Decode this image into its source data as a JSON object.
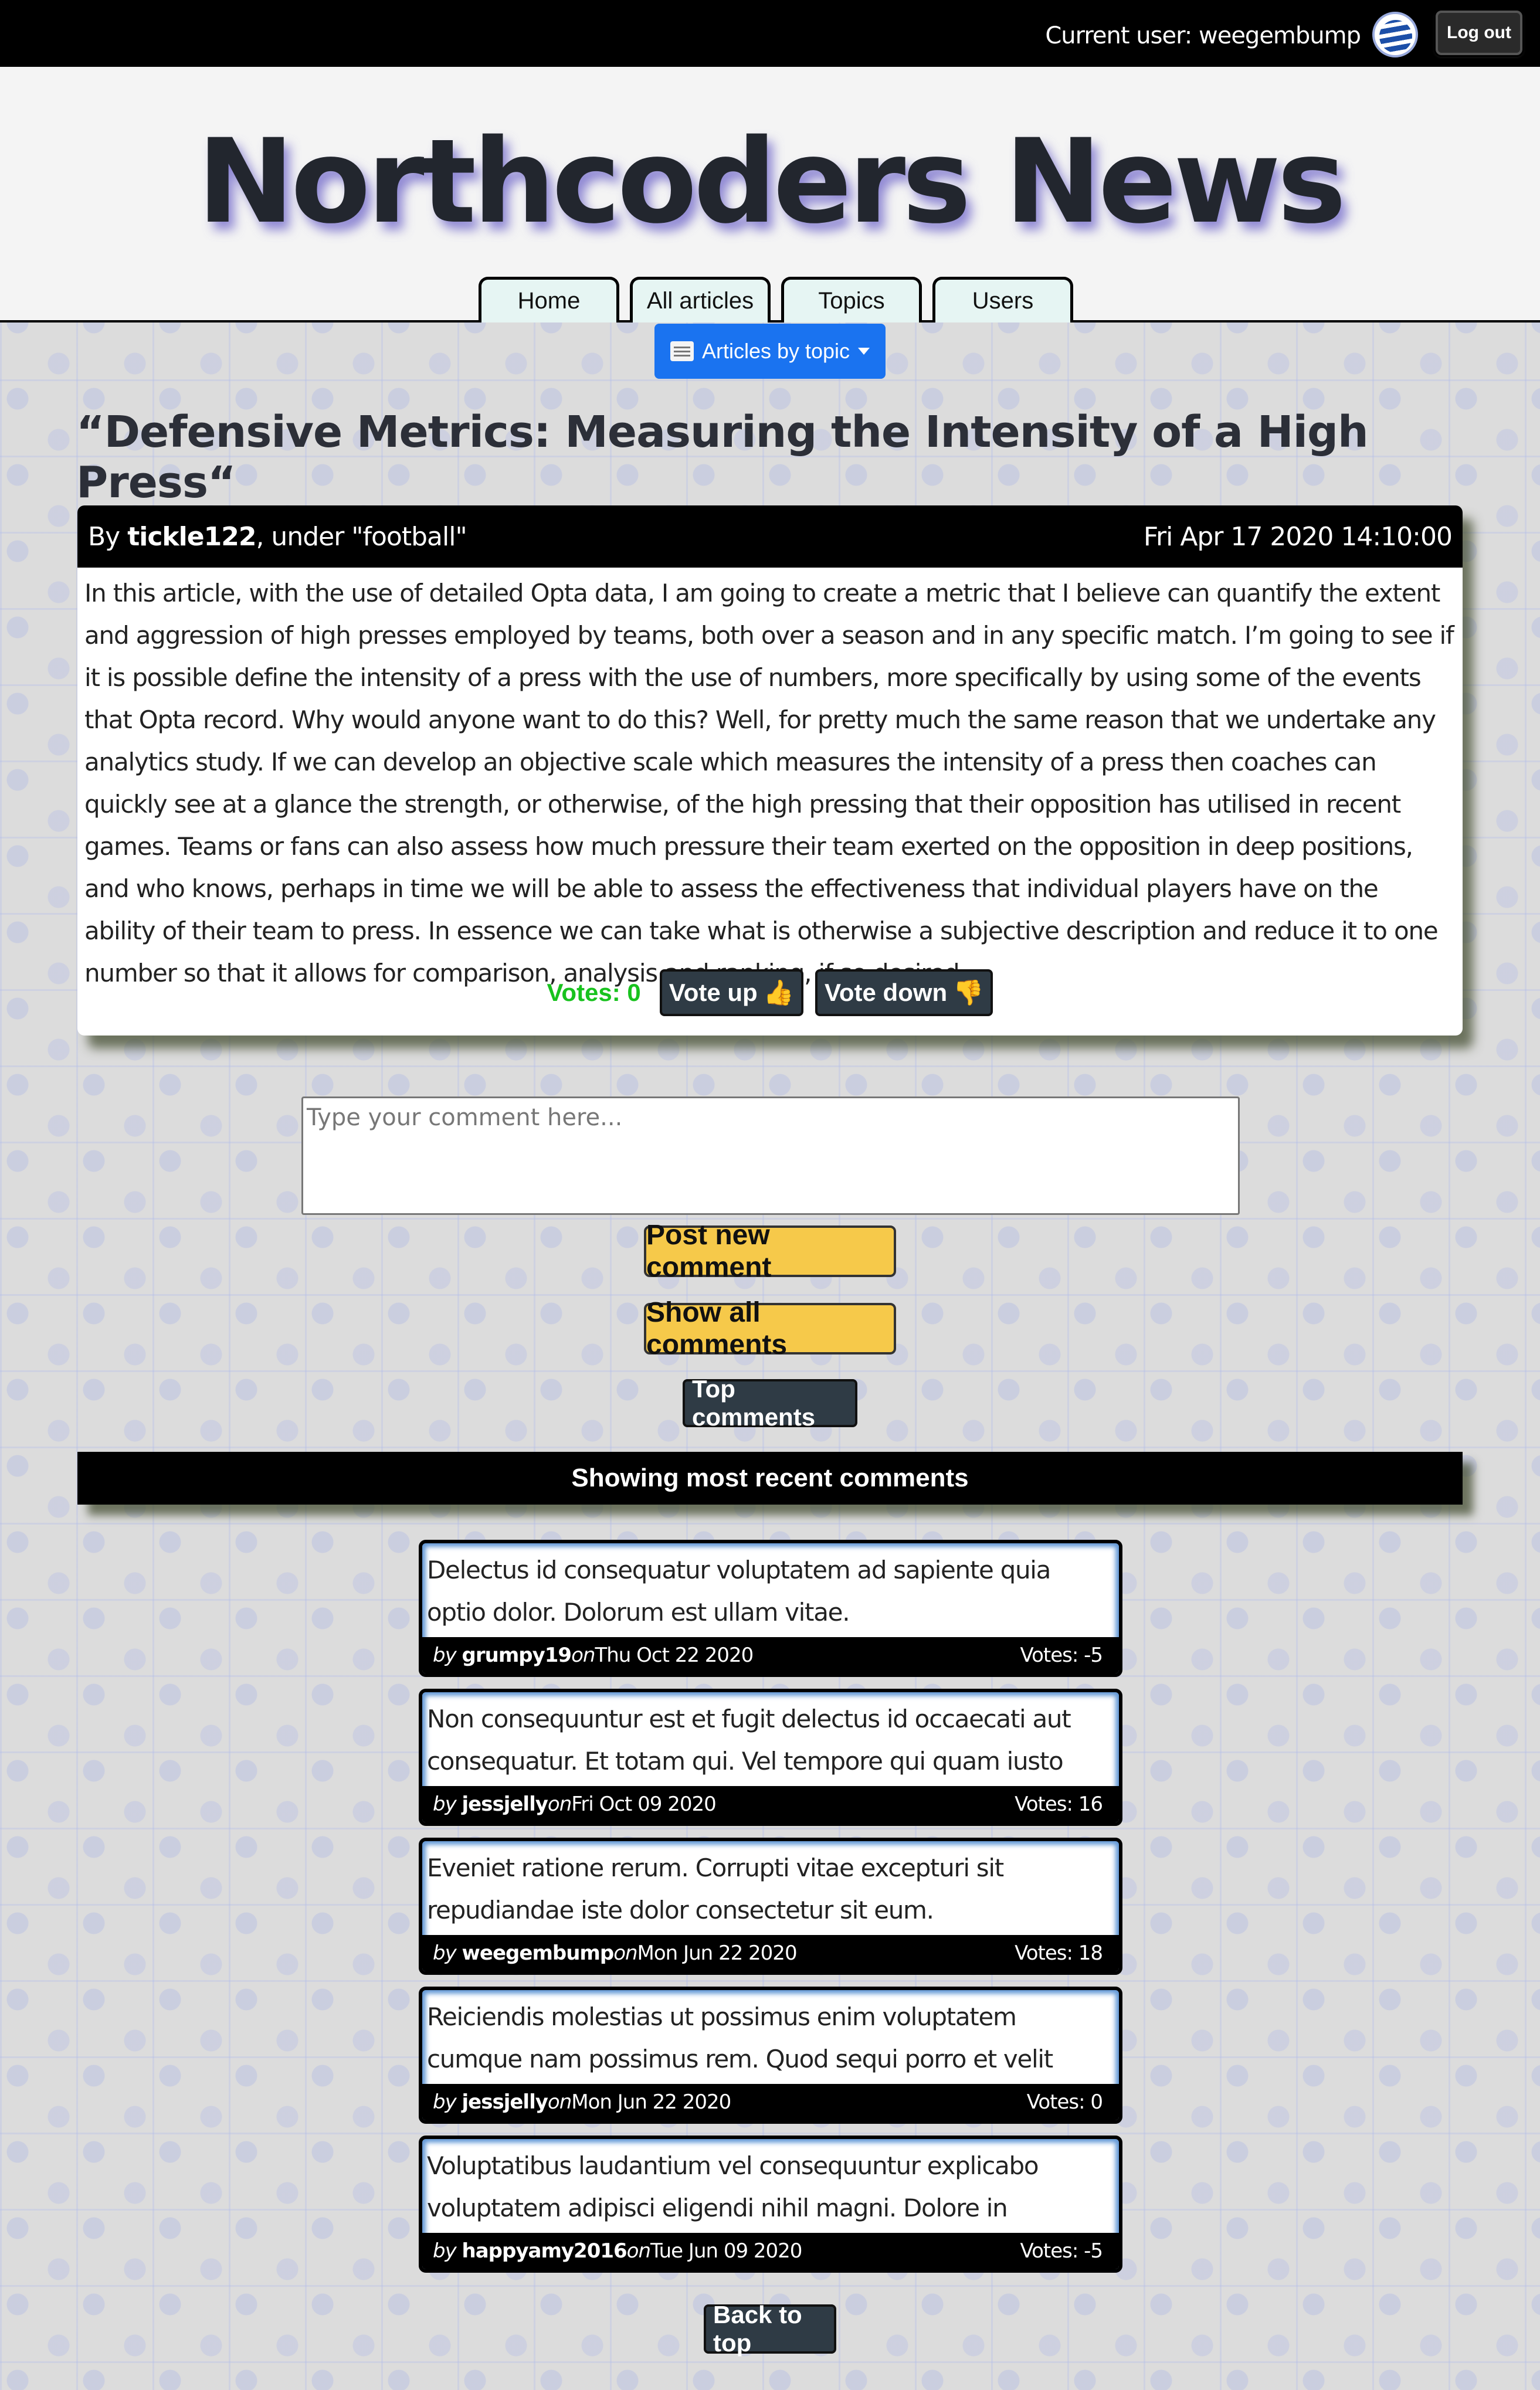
{
  "topbar": {
    "current_user": "Current user: weegembump",
    "logout_label": "Log out"
  },
  "header": {
    "title": "Northcoders News",
    "nav": [
      "Home",
      "All articles",
      "Topics",
      "Users"
    ]
  },
  "topic_dropdown": {
    "label": "Articles by topic",
    "icon": "newspaper-icon"
  },
  "article": {
    "title": "“Defensive Metrics: Measuring the Intensity of a High Press“",
    "by_prefix": "By ",
    "author": "tickle122",
    "topic_text": ", under \"football\"",
    "date": "Fri Apr 17 2020 14:10:00",
    "body": "In this article, with the use of detailed Opta data, I am going to create a metric that I believe can quantify the extent and aggression of high presses employed by teams, both over a season and in any specific match. I’m going to see if it is possible define the intensity of a press with the use of numbers, more specifically by using some of the events that Opta record. Why would anyone want to do this? Well, for pretty much the same reason that we undertake any analytics study. If we can develop an objective scale which measures the intensity of a press then coaches can quickly see at a glance the strength, or otherwise, of the high pressing that their opposition has utilised in recent games. Teams or fans can also assess how much pressure their team exerted on the opposition in deep positions, and who knows, perhaps in time we will be able to assess the effectiveness that individual players have on the ability of their team to press. In essence we can take what is otherwise a subjective description and reduce it to one number so that it allows for comparison, analysis and ranking, if so desired.",
    "votes": "Votes: 0",
    "vote_up": "Vote up",
    "vote_down": "Vote down"
  },
  "comment_form": {
    "placeholder": "Type your comment here...",
    "post_label": "Post new comment",
    "show_all_label": "Show all comments",
    "top_comments_label": "Top comments"
  },
  "comments_banner": "Showing most recent comments",
  "comments": [
    {
      "text": "Delectus id consequatur voluptatem ad sapiente quia optio dolor. Dolorum est ullam vitae.",
      "by": "by ",
      "author": "grumpy19",
      "on": "on",
      "date": "Thu Oct 22 2020",
      "votes": "Votes: -5"
    },
    {
      "text": "Non consequuntur est et fugit delectus id occaecati aut consequatur. Et totam qui. Vel tempore qui quam iusto adipisci...",
      "by": "by ",
      "author": "jessjelly",
      "on": "on",
      "date": "Fri Oct 09 2020",
      "votes": "Votes: 16"
    },
    {
      "text": "Eveniet ratione rerum. Corrupti vitae excepturi sit repudiandae iste dolor consectetur sit eum.",
      "by": "by ",
      "author": "weegembump",
      "on": "on",
      "date": "Mon Jun 22 2020",
      "votes": "Votes: 18"
    },
    {
      "text": "Reiciendis molestias ut possimus enim voluptatem cumque nam possimus rem. Quod sequi porro et velit dolor ut cupiditate...",
      "by": "by ",
      "author": "jessjelly",
      "on": "on",
      "date": "Mon Jun 22 2020",
      "votes": "Votes: 0"
    },
    {
      "text": "Voluptatibus laudantium vel consequuntur explicabo voluptatem adipisci eligendi nihil magni. Dolore in molestias ullam sapiente et...",
      "by": "by ",
      "author": "happyamy2016",
      "on": "on",
      "date": "Tue Jun 09 2020",
      "votes": "Votes: -5"
    }
  ],
  "back_to_top_label": "Back to top",
  "colors": {
    "accent_blue": "#1a73f0",
    "vote_green": "#18c21e",
    "button_yellow": "#f6c94a",
    "button_dark": "#2f3b45"
  }
}
